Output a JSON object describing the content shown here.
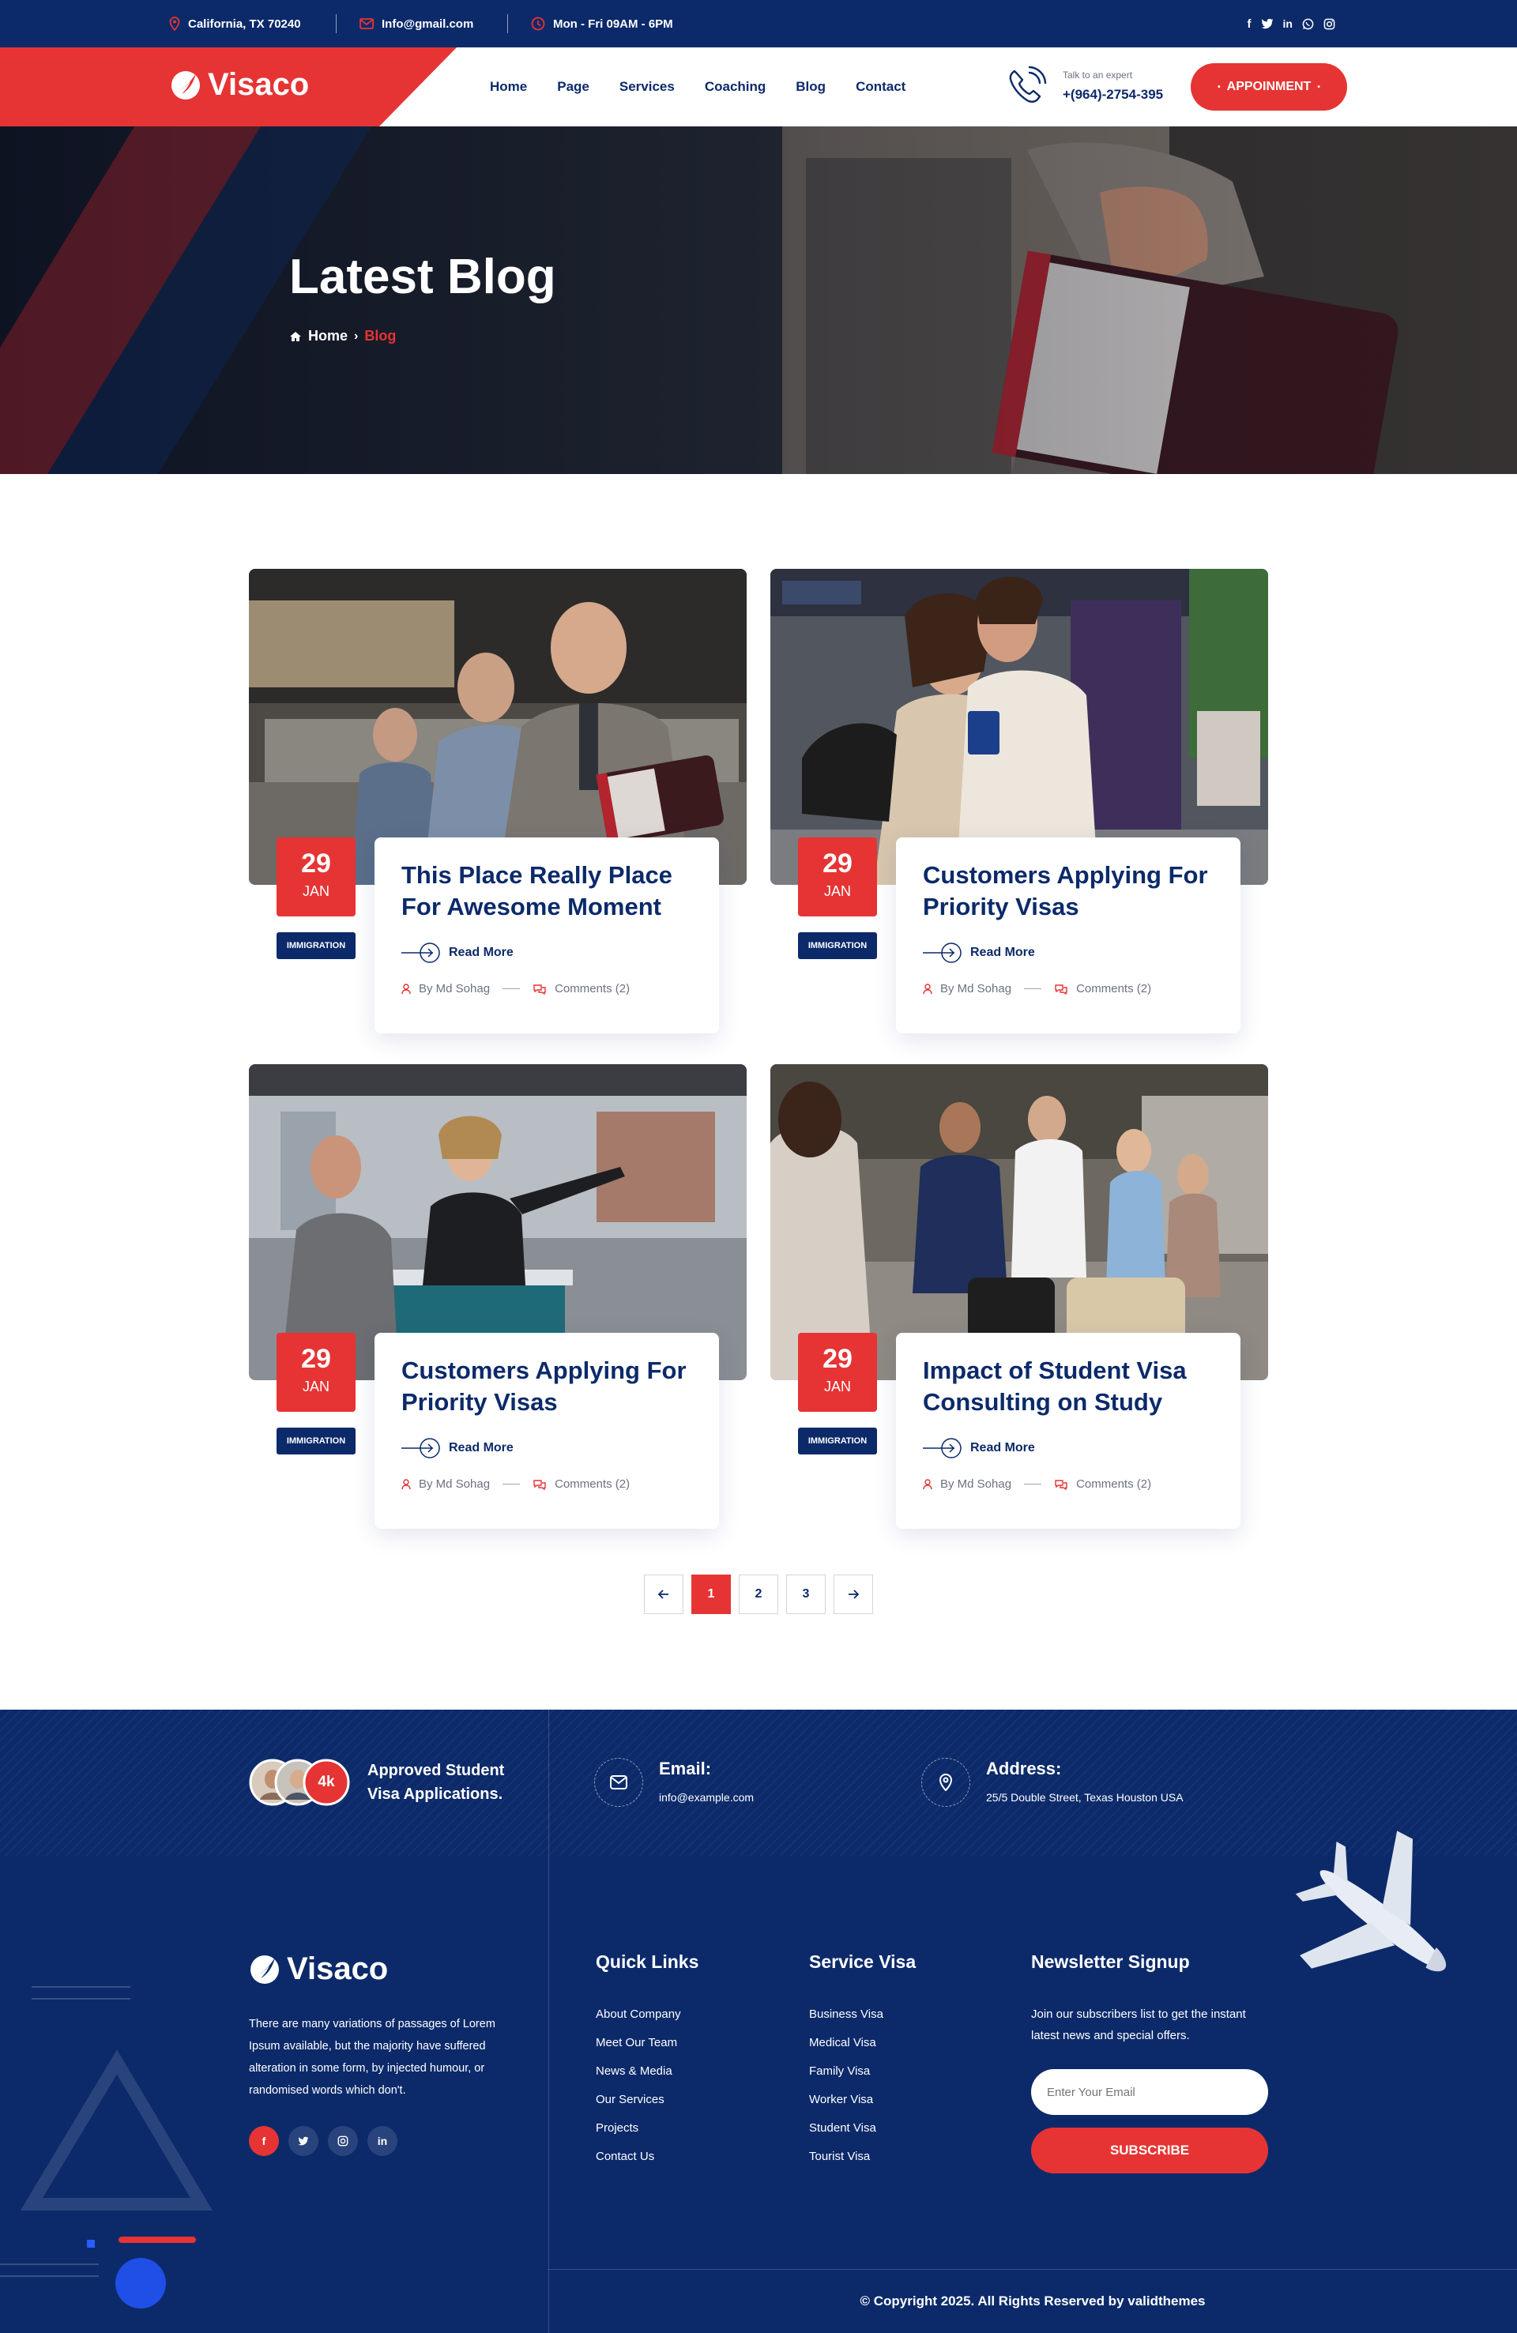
{
  "topbar": {
    "location": "California, TX 70240",
    "email": "Info@gmail.com",
    "hours": "Mon - Fri 09AM - 6PM",
    "social_icons": [
      "facebook-icon",
      "twitter-icon",
      "linkedin-icon",
      "whatsapp-icon",
      "instagram-icon"
    ]
  },
  "header": {
    "logo": "Visaco",
    "nav": [
      "Home",
      "Page",
      "Services",
      "Coaching",
      "Blog",
      "Contact"
    ],
    "talk_label": "Talk to an expert",
    "phone": "+(964)-2754-395",
    "appointment": "APPOINMENT"
  },
  "hero": {
    "title": "Latest Blog",
    "breadcrumb_home": "Home",
    "breadcrumb_current": "Blog"
  },
  "posts": [
    {
      "day": "29",
      "month": "JAN",
      "tag": "IMMIGRATION",
      "title": "This Place Really Place For Awesome Moment",
      "read_more": "Read More",
      "author": "By Md Sohag",
      "comments": "Comments (2)"
    },
    {
      "day": "29",
      "month": "JAN",
      "tag": "IMMIGRATION",
      "title": "Customers Applying For Priority Visas",
      "read_more": "Read More",
      "author": "By Md Sohag",
      "comments": "Comments (2)"
    },
    {
      "day": "29",
      "month": "JAN",
      "tag": "IMMIGRATION",
      "title": "Customers Applying For Priority Visas",
      "read_more": "Read More",
      "author": "By Md Sohag",
      "comments": "Comments (2)"
    },
    {
      "day": "29",
      "month": "JAN",
      "tag": "IMMIGRATION",
      "title": "Impact of Student Visa Consulting on Study",
      "read_more": "Read More",
      "author": "By Md Sohag",
      "comments": "Comments (2)"
    }
  ],
  "pagination": {
    "pages": [
      "1",
      "2",
      "3"
    ],
    "active": "1"
  },
  "footer": {
    "approved_count": "4k",
    "approved_text_1": "Approved Student",
    "approved_text_2": "Visa Applications.",
    "email_label": "Email:",
    "email_value": "info@example.com",
    "address_label": "Address:",
    "address_value": "25/5 Double Street, Texas Houston USA",
    "logo": "Visaco",
    "about": "There are many variations of passages of Lorem Ipsum available, but the majority have suffered alteration in some form, by injected humour, or randomised words which don't.",
    "quick_links_title": "Quick Links",
    "quick_links": [
      "About Company",
      "Meet Our Team",
      "News & Media",
      "Our Services",
      "Projects",
      "Contact Us"
    ],
    "service_title": "Service Visa",
    "service_links": [
      "Business Visa",
      "Medical Visa",
      "Family Visa",
      "Worker Visa",
      "Student Visa",
      "Tourist Visa"
    ],
    "newsletter_title": "Newsletter Signup",
    "newsletter_text": "Join our subscribers list to get the instant latest news and special offers.",
    "email_placeholder": "Enter Your Email",
    "subscribe": "SUBSCRIBE",
    "copyright": "© Copyright 2025. All Rights Reserved by validthemes"
  },
  "colors": {
    "primary": "#0c2a6a",
    "accent": "#e63434"
  }
}
